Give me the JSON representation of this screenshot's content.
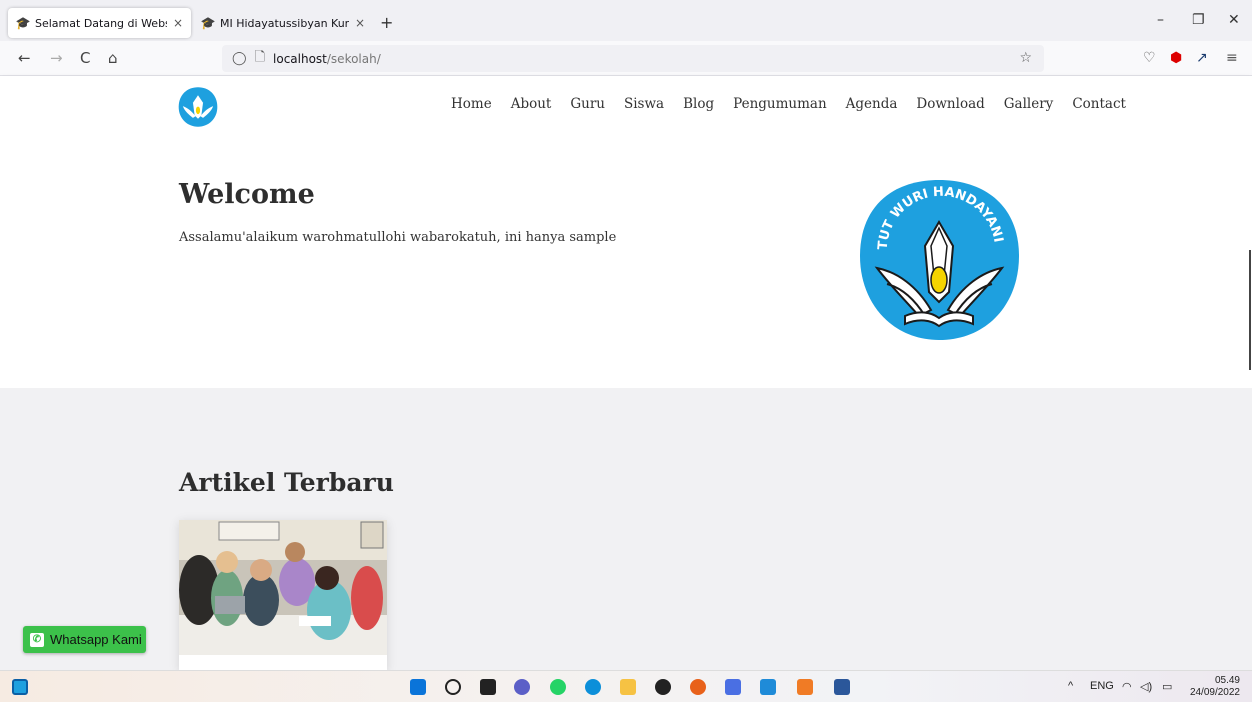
{
  "browser": {
    "tabs": [
      {
        "title": "Selamat Datang di Website Sek",
        "active": true,
        "close": "×"
      },
      {
        "title": "MI Hidayatussibyan Kumejing | ",
        "active": false,
        "close": "×"
      }
    ],
    "new_tab": "+",
    "window_controls": {
      "minimize": "–",
      "restore": "❐",
      "close": "✕"
    },
    "nav": {
      "back": "←",
      "forward": "→",
      "reload": "C",
      "home": "⌂"
    },
    "url_host": "localhost",
    "url_path": "/sekolah/",
    "bookmark_star": "☆"
  },
  "site": {
    "menu": [
      "Home",
      "About",
      "Guru",
      "Siswa",
      "Blog",
      "Pengumuman",
      "Agenda",
      "Download",
      "Gallery",
      "Contact"
    ],
    "welcome": {
      "title": "Welcome",
      "text": "Assalamu'alaikum warohmatullohi wabarokatuh, ini hanya sample"
    },
    "logo_motto": "TUT WURI HANDAYANI",
    "articles": {
      "title": "Artikel Terbaru"
    },
    "whatsapp_label": "Whatsapp Kami"
  },
  "colors": {
    "logo_blue": "#1ea0df",
    "whatsapp_green": "#3cc14a"
  },
  "taskbar": {
    "tray_lang": "ENG",
    "tray_chevron": "^",
    "time": "05.49",
    "date": "24/09/2022"
  }
}
